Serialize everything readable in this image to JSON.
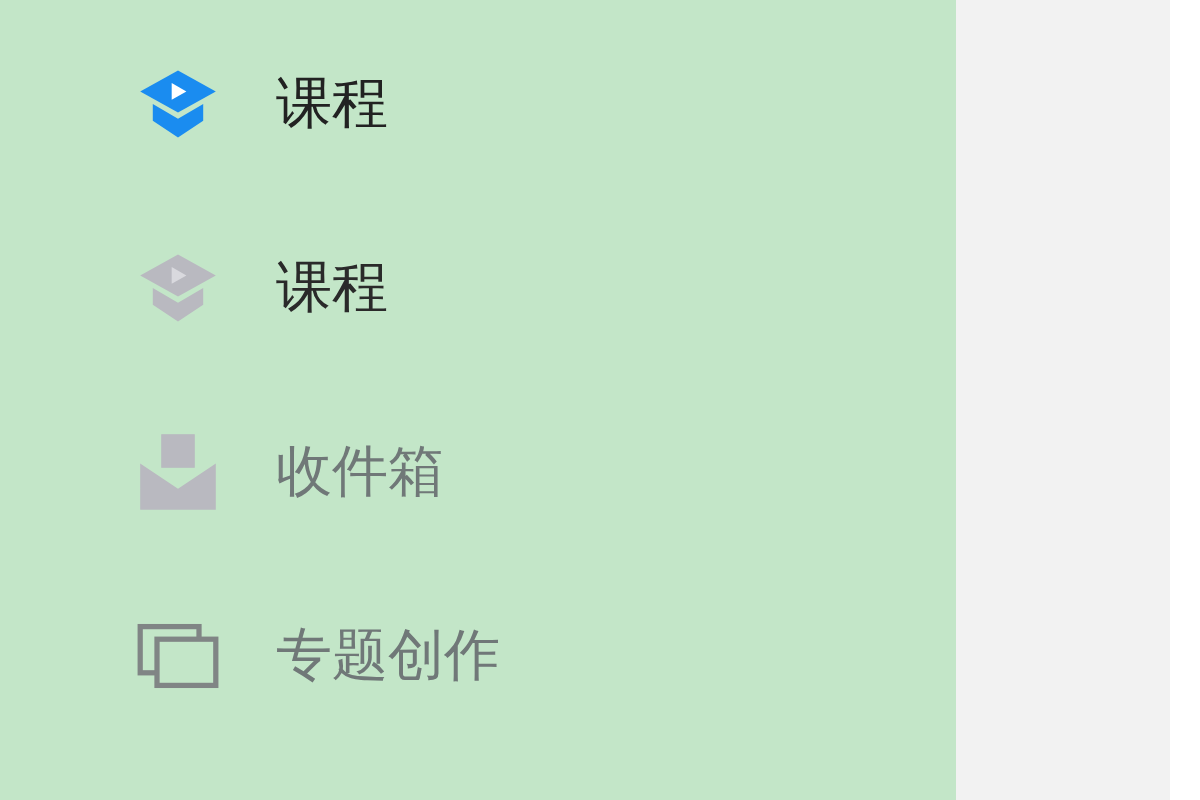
{
  "sidebar": {
    "items": [
      {
        "label": "课程",
        "kind": "course",
        "selected": true
      },
      {
        "label": "课程",
        "kind": "course",
        "selected": false
      },
      {
        "label": "收件箱",
        "kind": "inbox",
        "selected": false
      },
      {
        "label": "专题创作",
        "kind": "topic",
        "selected": false
      }
    ]
  }
}
